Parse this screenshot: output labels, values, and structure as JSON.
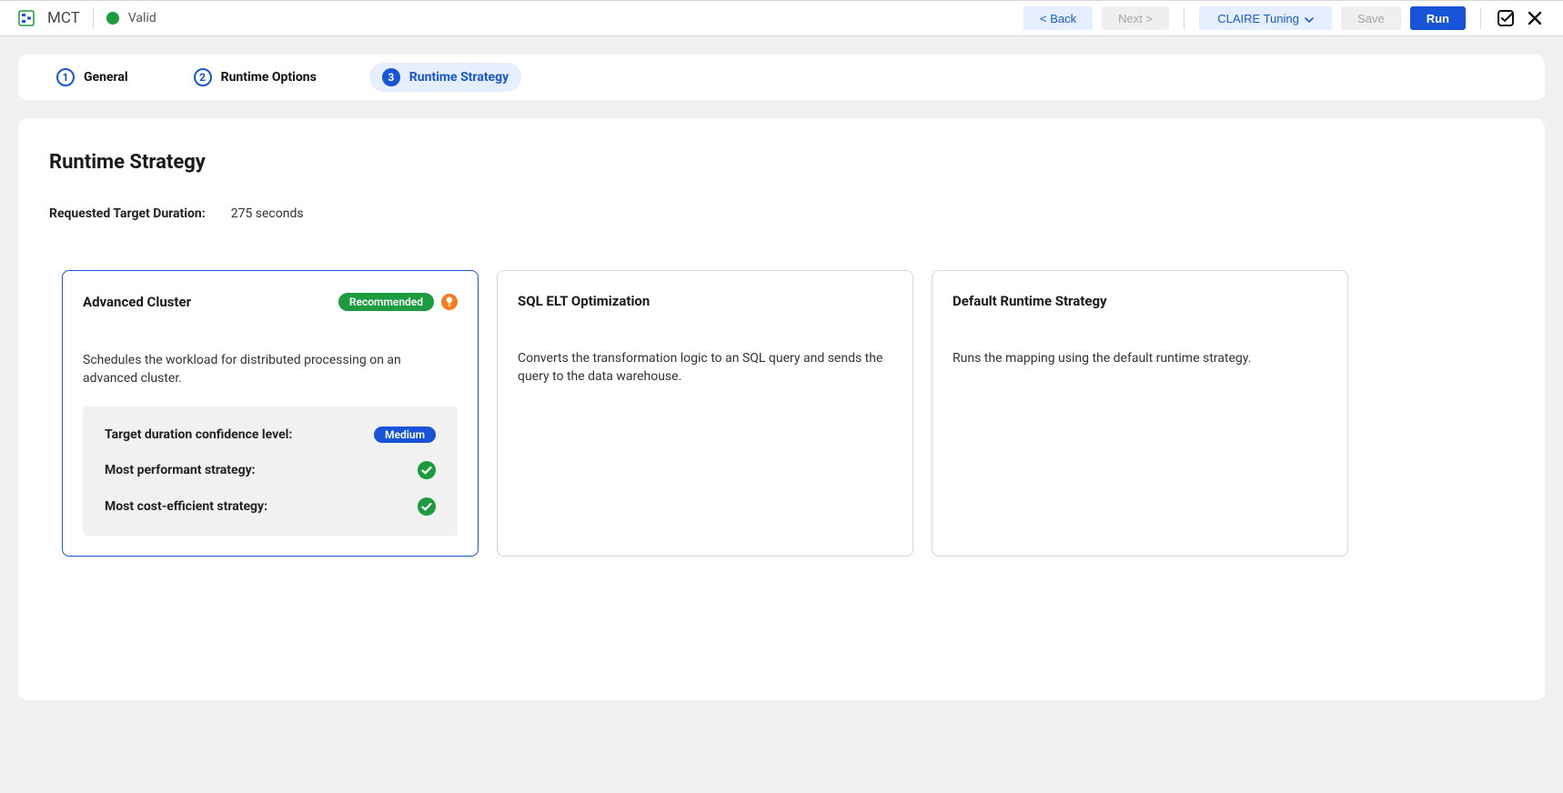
{
  "header": {
    "title": "MCT",
    "status_label": "Valid",
    "status_color": "#1d9c3f",
    "back_label": "< Back",
    "next_label": "Next >",
    "tuning_label": "CLAIRE Tuning",
    "save_label": "Save",
    "run_label": "Run"
  },
  "steps": [
    {
      "num": "1",
      "label": "General",
      "active": false
    },
    {
      "num": "2",
      "label": "Runtime Options",
      "active": false
    },
    {
      "num": "3",
      "label": "Runtime Strategy",
      "active": true
    }
  ],
  "page": {
    "title": "Runtime Strategy",
    "duration_label": "Requested Target Duration:",
    "duration_value": "275 seconds"
  },
  "cards": {
    "advanced": {
      "title": "Advanced Cluster",
      "recommended_label": "Recommended",
      "description": "Schedules the workload for distributed processing on an advanced cluster.",
      "details": {
        "confidence_label": "Target duration confidence level:",
        "confidence_value": "Medium",
        "performant_label": "Most performant strategy:",
        "cost_label": "Most cost-efficient strategy:"
      }
    },
    "sql": {
      "title": "SQL ELT Optimization",
      "description": "Converts the transformation logic to an SQL query and sends the query to the data warehouse."
    },
    "default": {
      "title": "Default Runtime Strategy",
      "description": "Runs the mapping using the default runtime strategy."
    }
  }
}
